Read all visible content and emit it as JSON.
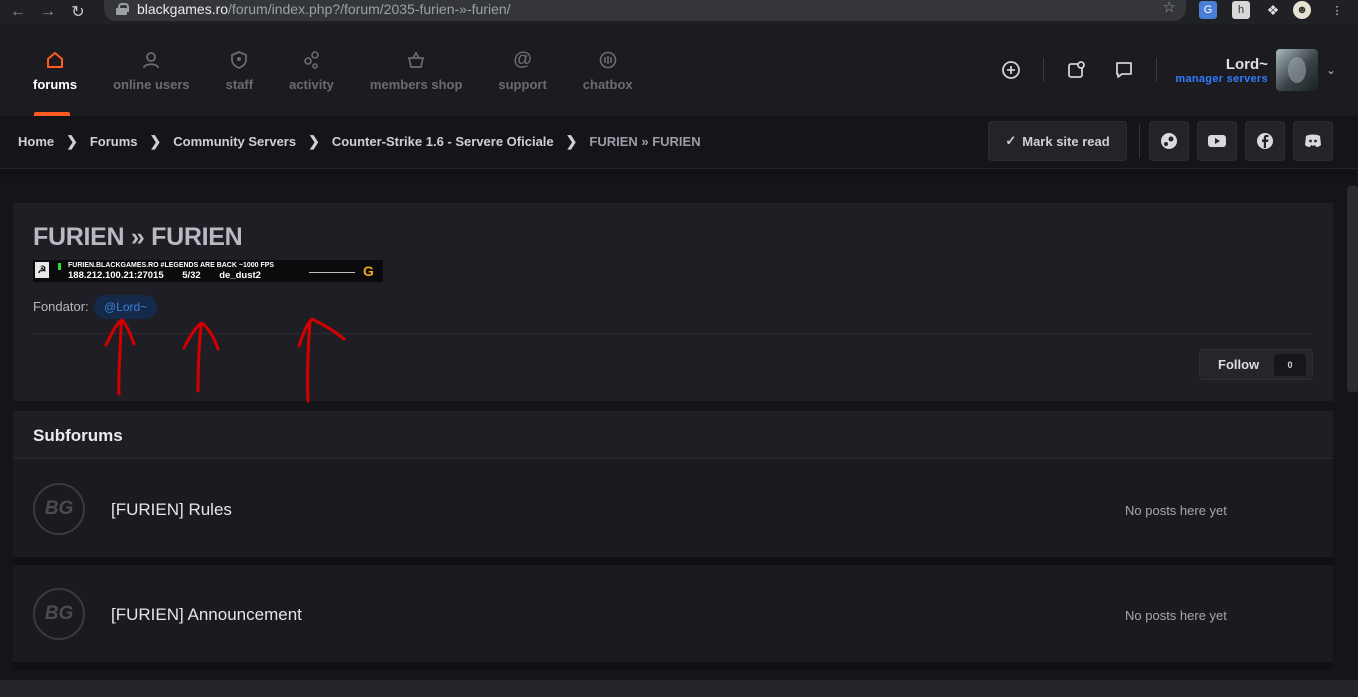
{
  "browser": {
    "url_host": "blackgames.ro",
    "url_path": "/forum/index.php?/forum/2035-furien-»-furien/"
  },
  "nav": {
    "items": [
      {
        "label": "forums",
        "icon": "home-icon",
        "active": true
      },
      {
        "label": "online users",
        "icon": "user-icon"
      },
      {
        "label": "staff",
        "icon": "shield-icon"
      },
      {
        "label": "activity",
        "icon": "activity-icon"
      },
      {
        "label": "members shop",
        "icon": "basket-icon"
      },
      {
        "label": "support",
        "icon": "at-icon"
      },
      {
        "label": "chatbox",
        "icon": "chat-waves-icon"
      }
    ]
  },
  "user": {
    "name": "Lord~",
    "role": "manager servers"
  },
  "breadcrumb": [
    "Home",
    "Forums",
    "Community Servers",
    "Counter-Strike 1.6 - Servere Oficiale",
    "FURIEN » FURIEN"
  ],
  "actions": {
    "mark_read": "Mark site read"
  },
  "social": [
    "steam-icon",
    "youtube-icon",
    "facebook-icon",
    "discord-icon"
  ],
  "forum": {
    "title": "FURIEN » FURIEN",
    "banner": {
      "name": "FURIEN.BLACKGAMES.RO #LEGENDS ARE BACK ~1000 FPS",
      "address": "188.212.100.21:27015",
      "players": "5/32",
      "map": "de_dust2"
    },
    "founder_label": "Fondator:",
    "founder_mention": "@Lord~",
    "follow_label": "Follow",
    "follow_count": "0"
  },
  "subforums": {
    "heading": "Subforums",
    "items": [
      {
        "name": "[FURIEN] Rules",
        "status": "No posts here yet"
      },
      {
        "name": "[FURIEN] Announcement",
        "status": "No posts here yet"
      }
    ]
  },
  "colors": {
    "accent": "#ff5a1f",
    "role": "#2f7dff",
    "mention": "#3f7fd8",
    "annotation": "#d40000"
  }
}
